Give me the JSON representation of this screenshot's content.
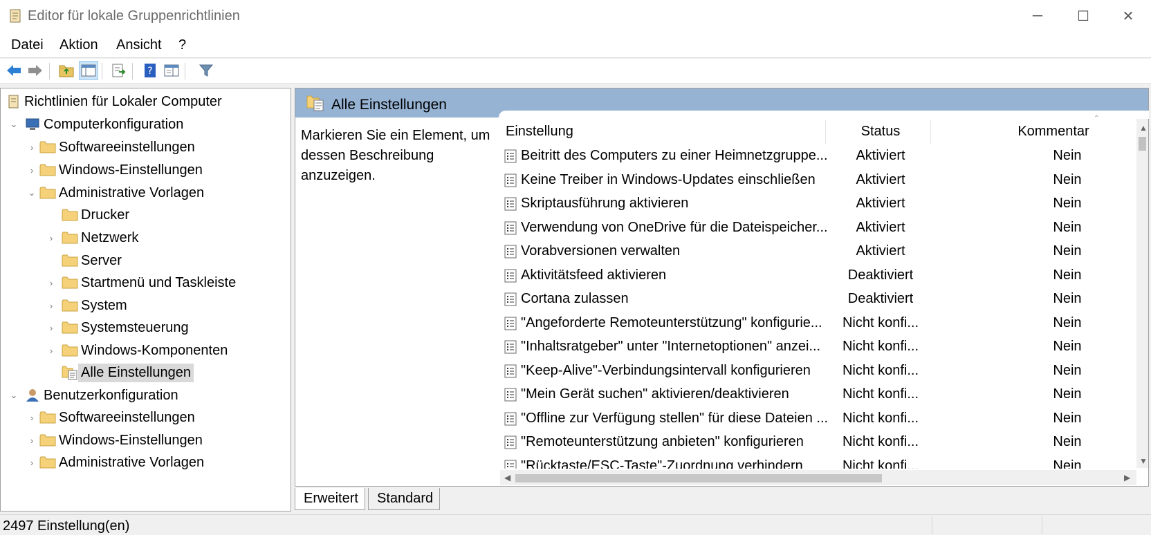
{
  "window": {
    "title": "Editor für lokale Gruppenrichtlinien",
    "minimize": "─",
    "maximize": "☐",
    "close": "✕"
  },
  "menu": [
    "Datei",
    "Aktion",
    "Ansicht",
    "?"
  ],
  "toolbar": {
    "icons": [
      "back-arrow-icon",
      "forward-arrow-icon",
      "up-folder-icon",
      "show-hide-tree-icon",
      "export-list-icon",
      "help-icon",
      "properties-icon",
      "filter-icon"
    ]
  },
  "tree": {
    "root": "Richtlinien für Lokaler Computer",
    "computer": "Computerkonfiguration",
    "computer_children": [
      "Softwareeinstellungen",
      "Windows-Einstellungen",
      "Administrative Vorlagen"
    ],
    "admin_children": [
      "Drucker",
      "Netzwerk",
      "Server",
      "Startmenü und Taskleiste",
      "System",
      "Systemsteuerung",
      "Windows-Komponenten",
      "Alle Einstellungen"
    ],
    "user": "Benutzerkonfiguration",
    "user_children": [
      "Softwareeinstellungen",
      "Windows-Einstellungen",
      "Administrative Vorlagen"
    ]
  },
  "pane": {
    "title": "Alle Einstellungen",
    "description": "Markieren Sie ein Element, um dessen Beschreibung anzuzeigen."
  },
  "columns": {
    "setting": "Einstellung",
    "status": "Status",
    "comment": "Kommentar"
  },
  "rows": [
    {
      "name": "Beitritt des Computers zu einer Heimnetzgruppe...",
      "status": "Aktiviert",
      "comment": "Nein"
    },
    {
      "name": "Keine Treiber in Windows-Updates einschließen",
      "status": "Aktiviert",
      "comment": "Nein"
    },
    {
      "name": "Skriptausführung aktivieren",
      "status": "Aktiviert",
      "comment": "Nein"
    },
    {
      "name": "Verwendung von OneDrive für die Dateispeicher...",
      "status": "Aktiviert",
      "comment": "Nein"
    },
    {
      "name": "Vorabversionen verwalten",
      "status": "Aktiviert",
      "comment": "Nein"
    },
    {
      "name": "Aktivitätsfeed aktivieren",
      "status": "Deaktiviert",
      "comment": "Nein"
    },
    {
      "name": "Cortana zulassen",
      "status": "Deaktiviert",
      "comment": "Nein"
    },
    {
      "name": "\"Angeforderte Remoteunterstützung\" konfigurie...",
      "status": "Nicht konfi...",
      "comment": "Nein"
    },
    {
      "name": "\"Inhaltsratgeber\" unter \"Internetoptionen\" anzei...",
      "status": "Nicht konfi...",
      "comment": "Nein"
    },
    {
      "name": "\"Keep-Alive\"-Verbindungsintervall konfigurieren",
      "status": "Nicht konfi...",
      "comment": "Nein"
    },
    {
      "name": "\"Mein Gerät suchen\" aktivieren/deaktivieren",
      "status": "Nicht konfi...",
      "comment": "Nein"
    },
    {
      "name": "\"Offline zur Verfügung stellen\" für diese Dateien ...",
      "status": "Nicht konfi...",
      "comment": "Nein"
    },
    {
      "name": "\"Remoteunterstützung anbieten\" konfigurieren",
      "status": "Nicht konfi...",
      "comment": "Nein"
    },
    {
      "name": "\"Rücktaste/ESC-Taste\"-Zuordnung verhindern",
      "status": "Nicht konfi...",
      "comment": "Nein"
    }
  ],
  "tabs": [
    "Erweitert",
    "Standard"
  ],
  "status_bar": "2497 Einstellung(en)"
}
